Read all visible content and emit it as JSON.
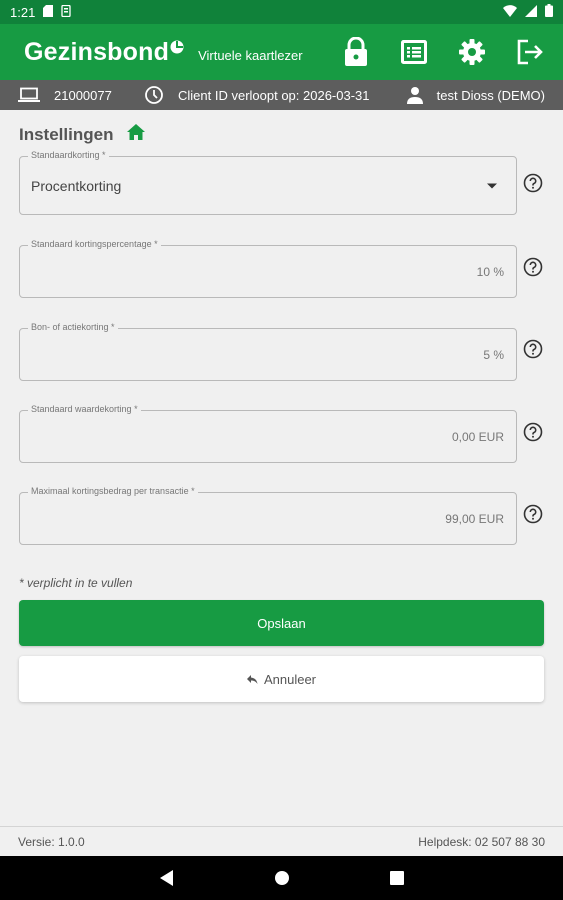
{
  "status_bar": {
    "time": "1:21"
  },
  "app_bar": {
    "logo": "Gezinsbond",
    "subtitle": "Virtuele kaartlezer",
    "actions": [
      "lock-icon",
      "list-icon",
      "gear-icon",
      "logout-icon"
    ]
  },
  "info_bar": {
    "device_id": "21000077",
    "client_expiry": "Client ID verloopt op: 2026-03-31",
    "user": "test Dioss (DEMO)"
  },
  "page": {
    "title": "Instellingen"
  },
  "fields": {
    "discount_type": {
      "label": "Standaardkorting *",
      "value": "Procentkorting"
    },
    "default_percentage": {
      "label": "Standaard kortingspercentage *",
      "value": "10 %"
    },
    "voucher_discount": {
      "label": "Bon- of actiekorting *",
      "value": "5 %"
    },
    "default_value_discount": {
      "label": "Standaard waardekorting *",
      "value": "0,00 EUR"
    },
    "max_discount": {
      "label": "Maximaal kortingsbedrag per transactie *",
      "value": "99,00 EUR"
    }
  },
  "required_note": "* verplicht in te vullen",
  "buttons": {
    "save": "Opslaan",
    "cancel": "Annuleer"
  },
  "footer": {
    "version": "Versie: 1.0.0",
    "helpdesk": "Helpdesk: 02 507 88 30"
  },
  "colors": {
    "primary": "#179b43",
    "status_bar": "#10823a",
    "info_bar": "#5d5d5d"
  }
}
